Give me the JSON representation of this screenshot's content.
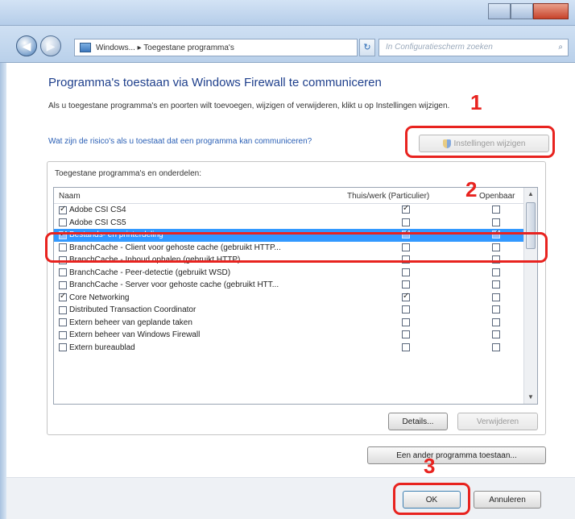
{
  "address": {
    "breadcrumb": "Windows... ▸ Toegestane programma's",
    "search_placeholder": "In Configuratiescherm zoeken"
  },
  "page": {
    "heading": "Programma's toestaan via Windows Firewall te communiceren",
    "subtext": "Als u toegestane programma's en poorten wilt toevoegen, wijzigen of verwijderen, klikt u op Instellingen wijzigen.",
    "link": "Wat zijn de risico's als u toestaat dat een programma kan communiceren?",
    "change_settings_button": "Instellingen wijzigen",
    "group_title": "Toegestane programma's en onderdelen:",
    "columns": {
      "name": "Naam",
      "private": "Thuis/werk (Particulier)",
      "public": "Openbaar"
    },
    "rows": [
      {
        "name": "Adobe CSI CS4",
        "enabled": true,
        "private": true,
        "public": false
      },
      {
        "name": "Adobe CSI CS5",
        "enabled": false,
        "private": false,
        "public": false
      },
      {
        "name": "Bestands- en printerdeling",
        "enabled": true,
        "private": true,
        "public": true
      },
      {
        "name": "BranchCache - Client voor gehoste cache (gebruikt HTTP...",
        "enabled": false,
        "private": false,
        "public": false
      },
      {
        "name": "BranchCache - Inhoud ophalen (gebruikt HTTP)",
        "enabled": false,
        "private": false,
        "public": false
      },
      {
        "name": "BranchCache - Peer-detectie (gebruikt WSD)",
        "enabled": false,
        "private": false,
        "public": false
      },
      {
        "name": "BranchCache - Server voor gehoste cache (gebruikt HTT...",
        "enabled": false,
        "private": false,
        "public": false
      },
      {
        "name": "Core Networking",
        "enabled": true,
        "private": true,
        "public": false
      },
      {
        "name": "Distributed Transaction Coordinator",
        "enabled": false,
        "private": false,
        "public": false
      },
      {
        "name": "Extern beheer van geplande taken",
        "enabled": false,
        "private": false,
        "public": false
      },
      {
        "name": "Extern beheer van Windows Firewall",
        "enabled": false,
        "private": false,
        "public": false
      },
      {
        "name": "Extern bureaublad",
        "enabled": false,
        "private": false,
        "public": false
      }
    ],
    "selected_row_index": 2,
    "details_button": "Details...",
    "remove_button": "Verwijderen",
    "add_program_button": "Een ander programma toestaan...",
    "ok_button": "OK",
    "cancel_button": "Annuleren"
  },
  "annotations": {
    "step1": "1",
    "step2": "2",
    "step3": "3",
    "color": "#e8231f"
  },
  "colors": {
    "heading": "#1e3f8c",
    "link": "#2a5fb5",
    "selection": "#3399ff"
  }
}
